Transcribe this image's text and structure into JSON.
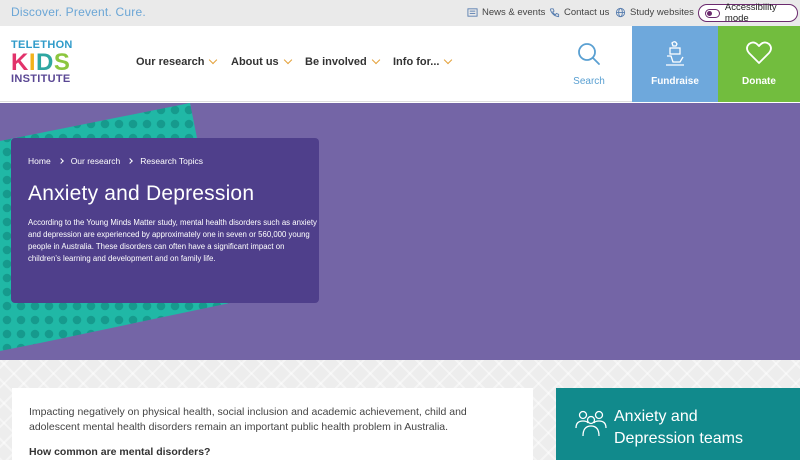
{
  "topbar": {
    "tagline": "Discover. Prevent. Cure.",
    "links": [
      {
        "label": "News & events",
        "icon": "newspaper-icon"
      },
      {
        "label": "Contact us",
        "icon": "phone-icon"
      },
      {
        "label": "Study websites",
        "icon": "globe-icon"
      }
    ],
    "accessibility_label": "Accessibility mode"
  },
  "logo": {
    "line1": "TELETHON",
    "line2_letters": [
      "K",
      "I",
      "D",
      "S"
    ],
    "line2_colors": [
      "#e2336b",
      "#f2b21a",
      "#2fa7a2",
      "#8cc63f"
    ],
    "line3": "INSTITUTE"
  },
  "nav": {
    "items": [
      "Our research",
      "About us",
      "Be involved",
      "Info for..."
    ],
    "search_label": "Search",
    "fundraise_label": "Fundraise",
    "donate_label": "Donate"
  },
  "hero": {
    "breadcrumb": [
      "Home",
      "Our research",
      "Research Topics"
    ],
    "title": "Anxiety and Depression",
    "lead": "According to the Young Minds Matter study, mental health disorders such as anxiety and depression are experienced by approximately one in seven or 560,000 young people in Australia. These disorders can often have a significant impact on children’s learning and development and on family life."
  },
  "content": {
    "paragraph": "Impacting negatively on physical health, social inclusion and academic achievement, child and adolescent mental health disorders remain an important public health problem in Australia.",
    "subheading": "How common are mental disorders?"
  },
  "teams_box": {
    "title_line1": "Anxiety and",
    "title_line2": "Depression teams"
  },
  "colors": {
    "hero_bg": "#7465a6",
    "card_bg": "#4f3f8b",
    "pattern_teal": "#20b8a6",
    "fundraise_bg": "#6ea8dc",
    "donate_bg": "#72bd3e",
    "teams_bg": "#118a8c",
    "accent_orange": "#e3a13a"
  }
}
